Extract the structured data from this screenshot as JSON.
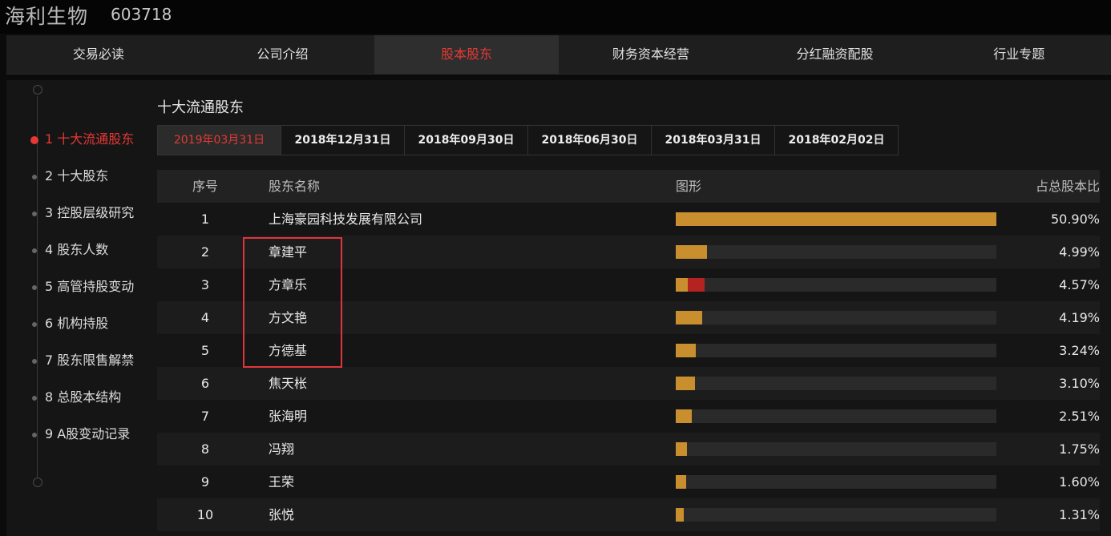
{
  "header": {
    "company_name": "海利生物",
    "company_code": "603718"
  },
  "top_nav": {
    "tabs": [
      {
        "label": "交易必读",
        "active": false
      },
      {
        "label": "公司介绍",
        "active": false
      },
      {
        "label": "股本股东",
        "active": true
      },
      {
        "label": "财务资本经营",
        "active": false
      },
      {
        "label": "分红融资配股",
        "active": false
      },
      {
        "label": "行业专题",
        "active": false
      }
    ]
  },
  "sidebar": {
    "items": [
      {
        "label": "1 十大流通股东",
        "active": true
      },
      {
        "label": "2 十大股东",
        "active": false
      },
      {
        "label": "3 控股层级研究",
        "active": false
      },
      {
        "label": "4 股东人数",
        "active": false
      },
      {
        "label": "5 高管持股变动",
        "active": false
      },
      {
        "label": "6 机构持股",
        "active": false
      },
      {
        "label": "7 股东限售解禁",
        "active": false
      },
      {
        "label": "8 总股本结构",
        "active": false
      },
      {
        "label": "9 A股变动记录",
        "active": false
      }
    ]
  },
  "main": {
    "section_title": "十大流通股东",
    "date_tabs": [
      {
        "label": "2019年03月31日",
        "active": true
      },
      {
        "label": "2018年12月31日",
        "active": false
      },
      {
        "label": "2018年09月30日",
        "active": false
      },
      {
        "label": "2018年06月30日",
        "active": false
      },
      {
        "label": "2018年03月31日",
        "active": false
      },
      {
        "label": "2018年02月02日",
        "active": false
      }
    ],
    "table": {
      "headers": {
        "index": "序号",
        "name": "股东名称",
        "figure": "图形",
        "percent": "占总股本比"
      },
      "rows": [
        {
          "index": "1",
          "name": "上海豪园科技发展有限公司",
          "percent": "50.90%",
          "value": 50.9,
          "red_share": 0
        },
        {
          "index": "2",
          "name": "章建平",
          "percent": "4.99%",
          "value": 4.99,
          "red_share": 0
        },
        {
          "index": "3",
          "name": "方章乐",
          "percent": "4.57%",
          "value": 4.57,
          "red_share": 2.7
        },
        {
          "index": "4",
          "name": "方文艳",
          "percent": "4.19%",
          "value": 4.19,
          "red_share": 0
        },
        {
          "index": "5",
          "name": "方德基",
          "percent": "3.24%",
          "value": 3.24,
          "red_share": 0
        },
        {
          "index": "6",
          "name": "焦天枨",
          "percent": "3.10%",
          "value": 3.1,
          "red_share": 0
        },
        {
          "index": "7",
          "name": "张海明",
          "percent": "2.51%",
          "value": 2.51,
          "red_share": 0
        },
        {
          "index": "8",
          "name": "冯翔",
          "percent": "1.75%",
          "value": 1.75,
          "red_share": 0
        },
        {
          "index": "9",
          "name": "王荣",
          "percent": "1.60%",
          "value": 1.6,
          "red_share": 0
        },
        {
          "index": "10",
          "name": "张悦",
          "percent": "1.31%",
          "value": 1.31,
          "red_share": 0
        }
      ]
    }
  },
  "colors": {
    "accent_red": "#e53935",
    "bar_gold": "#c98f2e",
    "bar_red": "#b52222",
    "highlight_red": "#e0363b"
  }
}
